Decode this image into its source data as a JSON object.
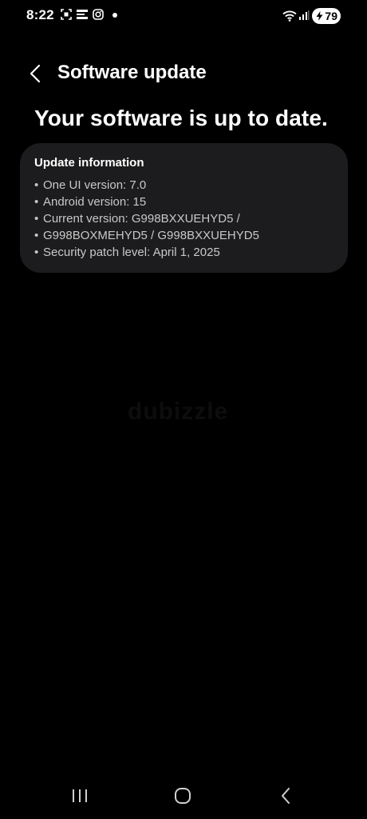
{
  "status_bar": {
    "time": "8:22",
    "battery_level": "79",
    "icons": [
      "screenshot-icon",
      "notification-app-icon",
      "instagram-icon",
      "wifi-icon",
      "signal-icon",
      "battery-icon"
    ]
  },
  "header": {
    "title": "Software update",
    "back_icon": "chevron-left-icon"
  },
  "status_headline": "Your software is up to date.",
  "update_info": {
    "title": "Update information",
    "items": [
      "One UI version: 7.0",
      "Android version: 15",
      "Current version: G998BXXUEHYD5 /",
      "G998BOXMEHYD5 / G998BXXUEHYD5",
      "Security patch level: April 1, 2025"
    ]
  },
  "watermark": "dubizzle",
  "nav_bar": {
    "icons": [
      "recent-apps-icon",
      "home-icon",
      "back-icon"
    ]
  },
  "colors": {
    "background": "#000000",
    "card": "#1c1c1e",
    "text_primary": "#ffffff",
    "text_secondary": "#c8c8c8"
  }
}
